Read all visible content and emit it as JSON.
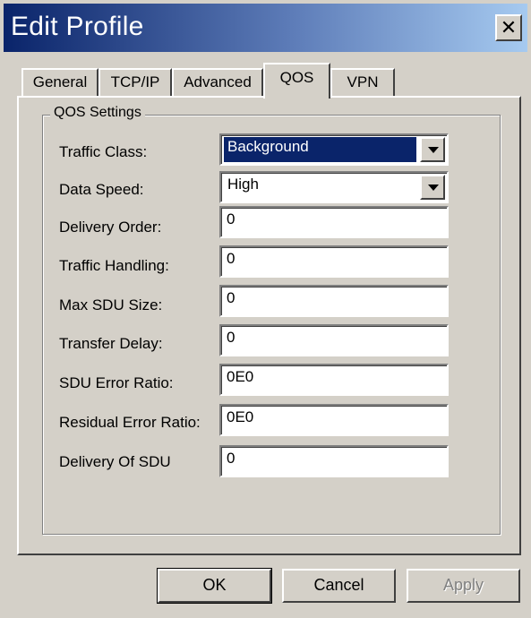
{
  "window": {
    "title": "Edit Profile",
    "close_label": "✕"
  },
  "tabs": [
    {
      "label": "General"
    },
    {
      "label": "TCP/IP"
    },
    {
      "label": "Advanced"
    },
    {
      "label": "QOS"
    },
    {
      "label": "VPN"
    }
  ],
  "active_tab": "QOS",
  "group": {
    "title": "QOS Settings"
  },
  "fields": {
    "traffic_class": {
      "label": "Traffic Class:",
      "value": "Background"
    },
    "data_speed": {
      "label": "Data Speed:",
      "value": "High"
    },
    "delivery_order": {
      "label": "Delivery Order:",
      "value": "0"
    },
    "traffic_handling": {
      "label": "Traffic Handling:",
      "value": "0"
    },
    "max_sdu_size": {
      "label": "Max SDU Size:",
      "value": "0"
    },
    "transfer_delay": {
      "label": "Transfer Delay:",
      "value": "0"
    },
    "sdu_error_ratio": {
      "label": "SDU Error Ratio:",
      "value": "0E0"
    },
    "residual_error_ratio": {
      "label": "Residual Error Ratio:",
      "value": "0E0"
    },
    "delivery_of_sdu": {
      "label": "Delivery Of SDU",
      "value": "0"
    }
  },
  "buttons": {
    "ok": "OK",
    "cancel": "Cancel",
    "apply": "Apply"
  },
  "colors": {
    "selection": "#0a246a",
    "face": "#d4d0c8"
  }
}
